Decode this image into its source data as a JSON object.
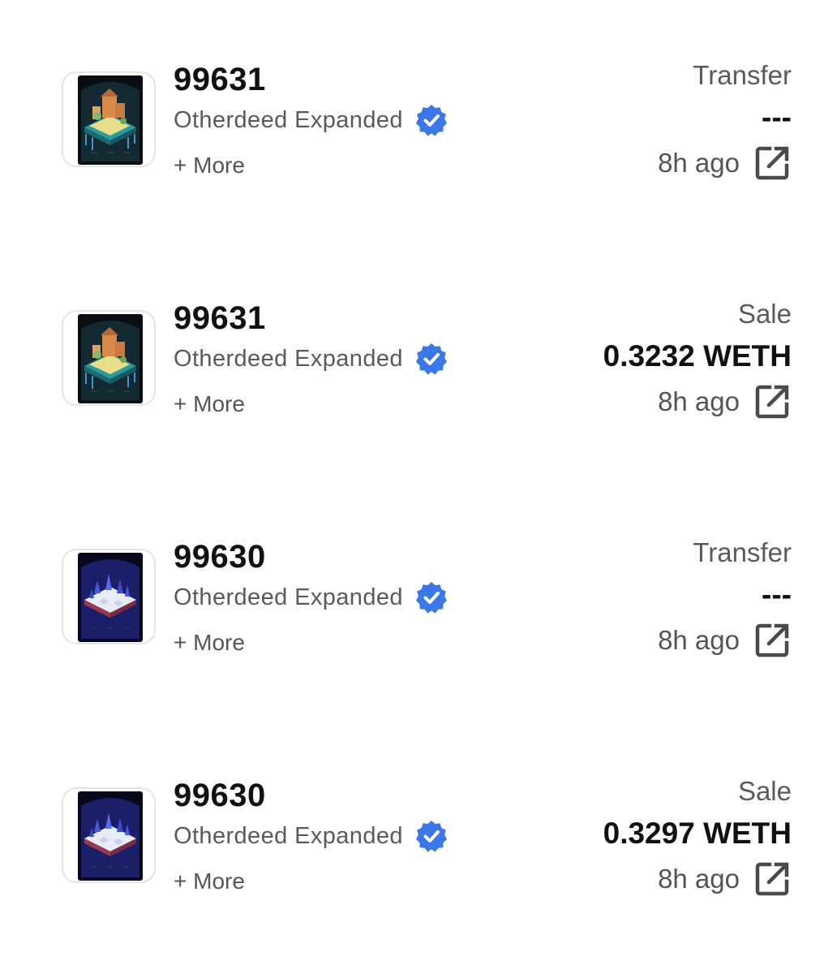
{
  "activities": [
    {
      "token_id": "99631",
      "collection": "Otherdeed Expanded",
      "more_label": "+ More",
      "event_type": "Transfer",
      "price": "---",
      "time": "8h ago",
      "thumbnail_icon": "otherdeed-land-warm-icon",
      "verified_icon": "verified-badge-icon",
      "link_icon": "external-link-icon"
    },
    {
      "token_id": "99631",
      "collection": "Otherdeed Expanded",
      "more_label": "+ More",
      "event_type": "Sale",
      "price": "0.3232 WETH",
      "time": "8h ago",
      "thumbnail_icon": "otherdeed-land-warm-icon",
      "verified_icon": "verified-badge-icon",
      "link_icon": "external-link-icon"
    },
    {
      "token_id": "99630",
      "collection": "Otherdeed Expanded",
      "more_label": "+ More",
      "event_type": "Transfer",
      "price": "---",
      "time": "8h ago",
      "thumbnail_icon": "otherdeed-land-blue-icon",
      "verified_icon": "verified-badge-icon",
      "link_icon": "external-link-icon"
    },
    {
      "token_id": "99630",
      "collection": "Otherdeed Expanded",
      "more_label": "+ More",
      "event_type": "Sale",
      "price": "0.3297 WETH",
      "time": "8h ago",
      "thumbnail_icon": "otherdeed-land-blue-icon",
      "verified_icon": "verified-badge-icon",
      "link_icon": "external-link-icon"
    }
  ],
  "colors": {
    "verified_blue": "#3b78e7",
    "text_primary": "#111111",
    "text_secondary": "#5a5a5a",
    "border": "#e5e5e5"
  }
}
